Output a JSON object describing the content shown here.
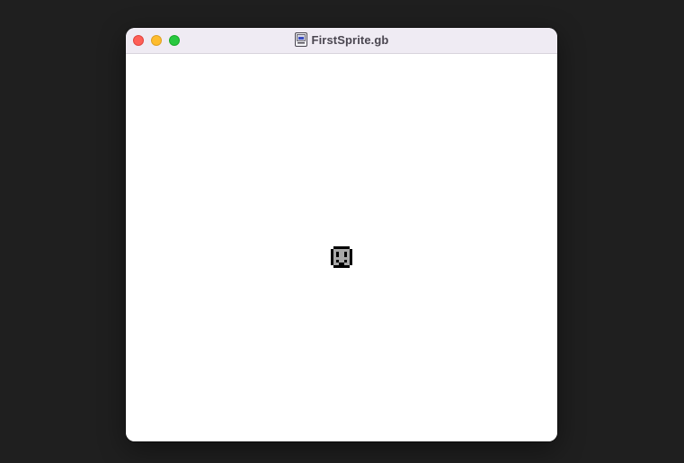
{
  "window": {
    "title": "FirstSprite.gb",
    "controls": {
      "close": "close",
      "minimize": "minimize",
      "zoom": "zoom"
    },
    "colors": {
      "close": "#fe5f57",
      "minimize": "#febc2e",
      "zoom": "#28c840",
      "titlebar": "#efebf3"
    }
  },
  "icons": {
    "document": "cartridge-document-icon",
    "sprite": "smiley-face-sprite"
  },
  "sprite_colors": {
    "outline": "#000000",
    "fill": "#a8a8a8",
    "features": "#000000"
  }
}
